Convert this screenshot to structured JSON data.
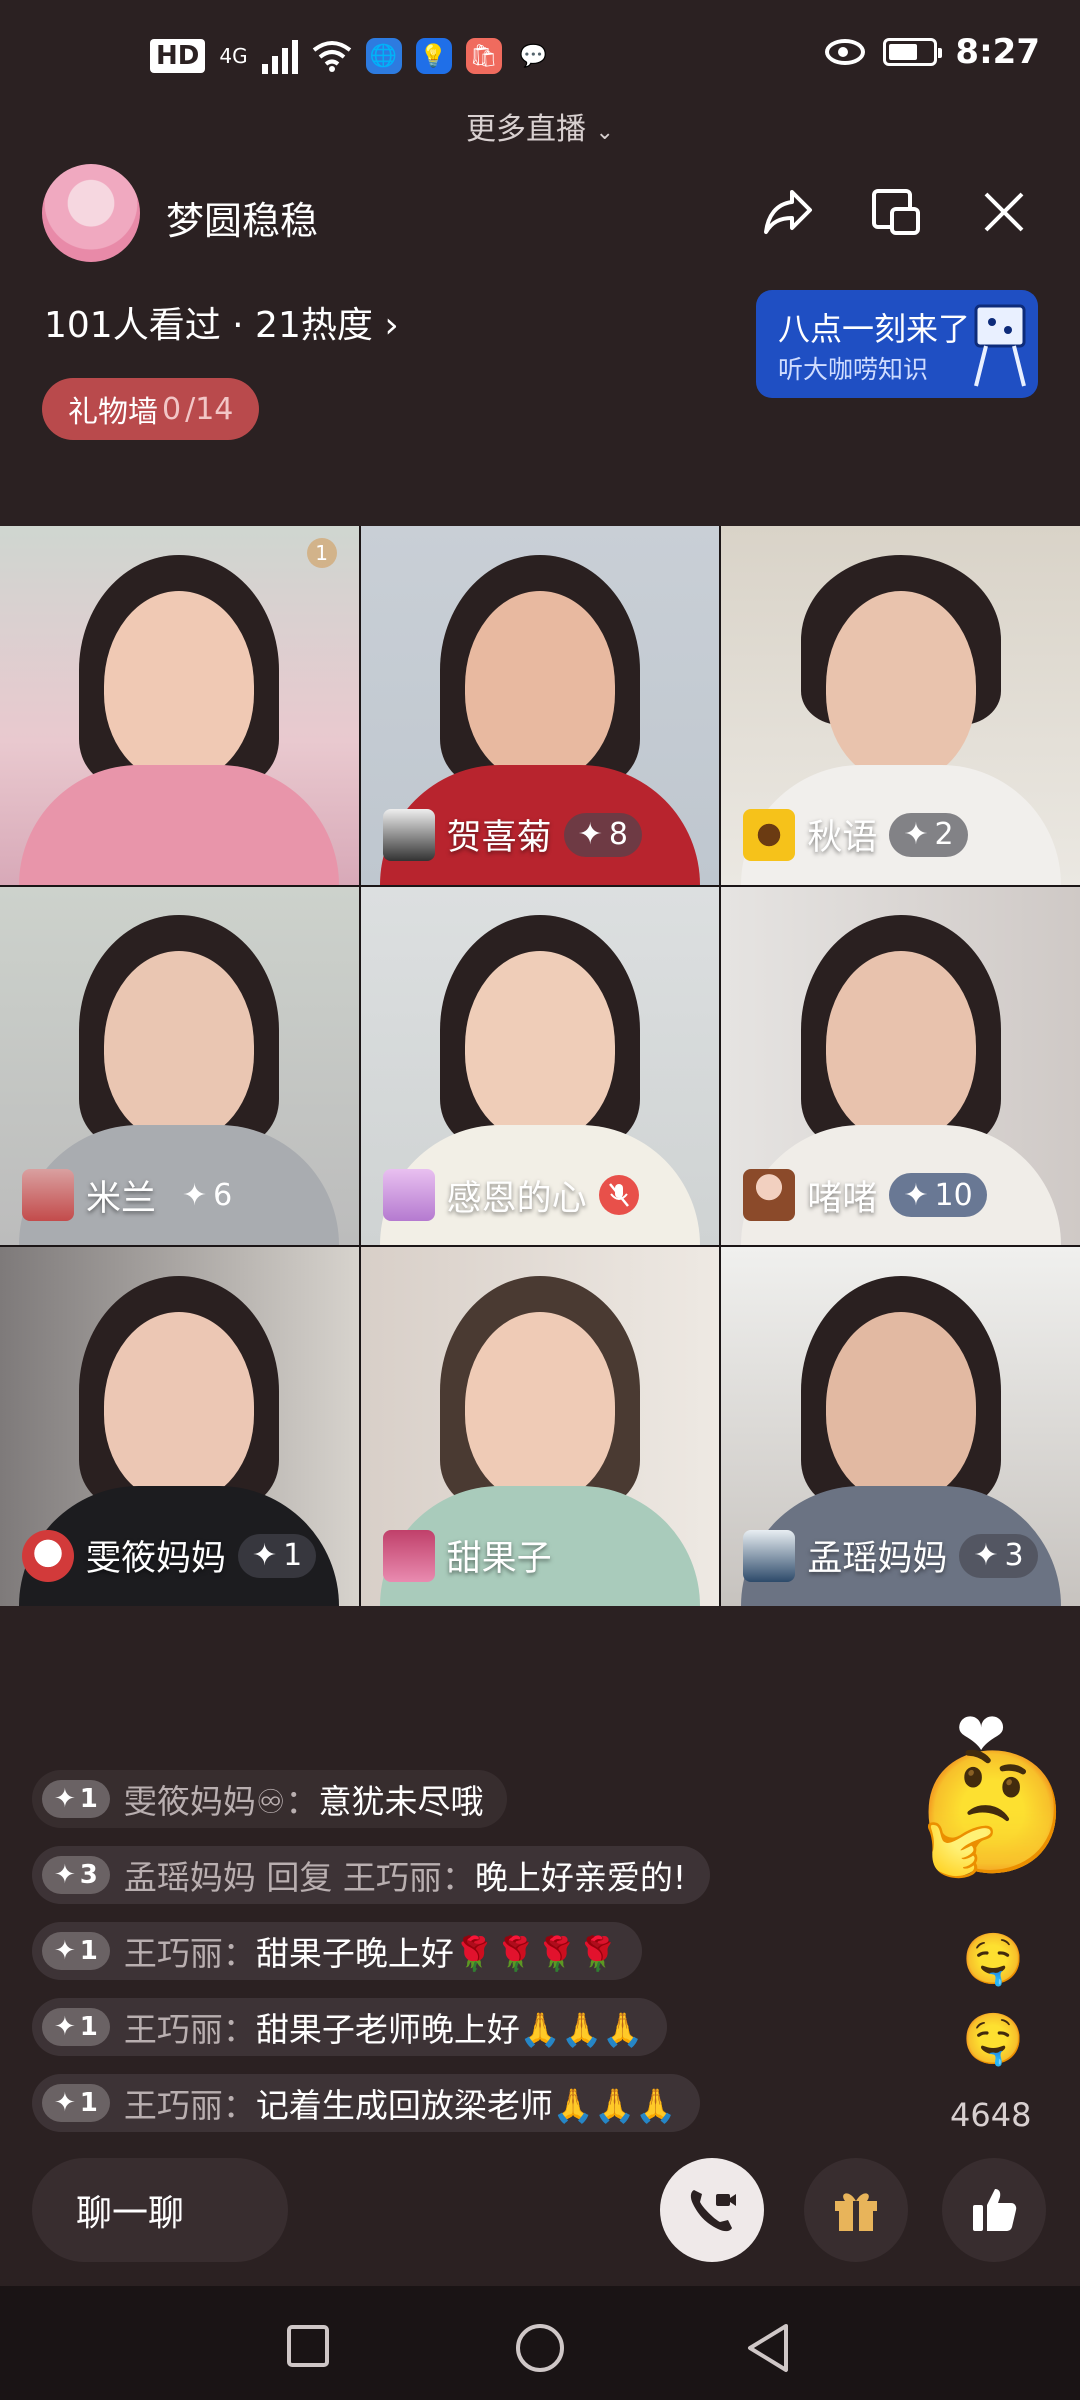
{
  "status_bar": {
    "hd": "HD",
    "network": "4G",
    "time": "8:27",
    "battery_level": 0.65
  },
  "more_live": {
    "label": "更多直播"
  },
  "host": {
    "name": "梦圆稳稳"
  },
  "stats": {
    "viewers": "101人看过 · 21热度"
  },
  "gift_wall": {
    "label": "礼物墙",
    "count": "0",
    "total": "/14"
  },
  "promo": {
    "title": "八点一刻来了",
    "subtitle": "听大咖唠知识"
  },
  "participants": [
    {
      "name": "",
      "badge": "",
      "rank": "1"
    },
    {
      "name": "贺喜菊",
      "badge": "8"
    },
    {
      "name": "秋语",
      "badge": "2"
    },
    {
      "name": "米兰",
      "badge": "6"
    },
    {
      "name": "感恩的心",
      "badge": ""
    },
    {
      "name": "啫啫",
      "badge": "10"
    },
    {
      "name": "雯筱妈妈",
      "badge": "1"
    },
    {
      "name": "甜果子",
      "badge": ""
    },
    {
      "name": "孟瑶妈妈",
      "badge": "3"
    }
  ],
  "chat_messages": [
    {
      "level": "1",
      "user": "雯筱妈妈♾：",
      "text": "意犹未尽哦"
    },
    {
      "level": "3",
      "user": "孟瑶妈妈 回复 王巧丽：",
      "text": "晚上好亲爱的!"
    },
    {
      "level": "1",
      "user": "王巧丽：",
      "text": "甜果子晚上好🌹🌹🌹🌹"
    },
    {
      "level": "1",
      "user": "王巧丽：",
      "text": "甜果子老师晚上好🙏🙏🙏"
    },
    {
      "level": "1",
      "user": "王巧丽：",
      "text": "记着生成回放梁老师🙏🙏🙏"
    }
  ],
  "likes": {
    "count": "4648"
  },
  "bottom": {
    "chat_placeholder": "聊一聊"
  },
  "colors": {
    "gift_wall": "#b94a4c",
    "promo": "#1f4fc3",
    "mic_off": "#e8504a",
    "background": "#2b2122"
  }
}
